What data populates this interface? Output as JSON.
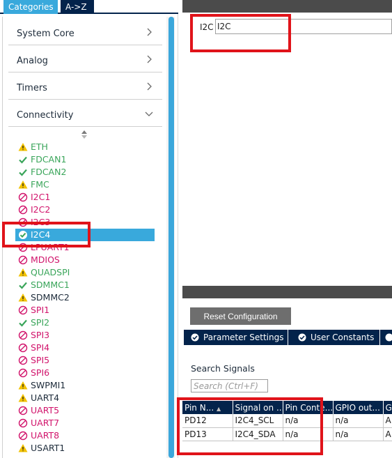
{
  "tabs": {
    "categories": "Categories",
    "az": "A->Z"
  },
  "categories": [
    {
      "label": "System Core",
      "state": "collapsed"
    },
    {
      "label": "Analog",
      "state": "collapsed"
    },
    {
      "label": "Timers",
      "state": "collapsed"
    },
    {
      "label": "Connectivity",
      "state": "expanded"
    }
  ],
  "peripherals": [
    {
      "name": "ETH",
      "status": "warning"
    },
    {
      "name": "FDCAN1",
      "status": "ok"
    },
    {
      "name": "FDCAN2",
      "status": "ok"
    },
    {
      "name": "FMC",
      "status": "warning"
    },
    {
      "name": "I2C1",
      "status": "disabled"
    },
    {
      "name": "I2C2",
      "status": "disabled"
    },
    {
      "name": "I2C3",
      "status": "disabled"
    },
    {
      "name": "I2C4",
      "status": "ok",
      "selected": true
    },
    {
      "name": "LPUART1",
      "status": "disabled"
    },
    {
      "name": "MDIOS",
      "status": "disabled"
    },
    {
      "name": "QUADSPI",
      "status": "warning"
    },
    {
      "name": "SDMMC1",
      "status": "ok"
    },
    {
      "name": "SDMMC2",
      "status": "warning"
    },
    {
      "name": "SPI1",
      "status": "disabled"
    },
    {
      "name": "SPI2",
      "status": "ok"
    },
    {
      "name": "SPI3",
      "status": "disabled"
    },
    {
      "name": "SPI4",
      "status": "disabled"
    },
    {
      "name": "SPI5",
      "status": "disabled"
    },
    {
      "name": "SPI6",
      "status": "disabled"
    },
    {
      "name": "SWPMI1",
      "status": "warning"
    },
    {
      "name": "UART4",
      "status": "warning"
    },
    {
      "name": "UART5",
      "status": "disabled"
    },
    {
      "name": "UART7",
      "status": "disabled"
    },
    {
      "name": "UART8",
      "status": "disabled"
    },
    {
      "name": "USART1",
      "status": "warning"
    }
  ],
  "config": {
    "name_label": "I2C",
    "name_value": "I2C"
  },
  "bottom": {
    "reset_label": "Reset Configuration",
    "tabs": [
      "Parameter Settings",
      "User Constants"
    ],
    "search_label": "Search Signals",
    "search_placeholder": "Search (Ctrl+F)"
  },
  "signal_table": {
    "columns": [
      "Pin N...",
      "Signal on ...",
      "Pin Conte...",
      "GPIO out...",
      "G"
    ],
    "rows": [
      [
        "PD12",
        "I2C4_SCL",
        "n/a",
        "n/a",
        "A"
      ],
      [
        "PD13",
        "I2C4_SDA",
        "n/a",
        "n/a",
        "A"
      ]
    ]
  },
  "colors": {
    "ok": "#3aa55a",
    "warning": "#f2c200",
    "disabled": "#d1136b",
    "selected": "#39a9dc",
    "header": "#03234b",
    "highlight": "#e0131a"
  }
}
